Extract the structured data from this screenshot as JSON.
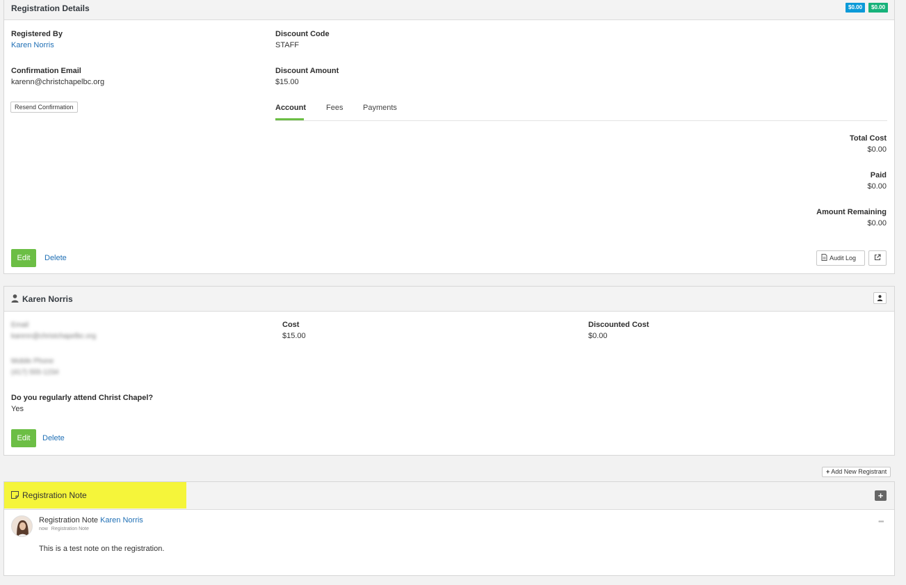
{
  "registration": {
    "title": "Registration Details",
    "badge_blue": "$0.00",
    "badge_green": "$0.00",
    "registered_by_label": "Registered By",
    "registered_by": "Karen Norris",
    "confirmation_email_label": "Confirmation Email",
    "confirmation_email": "karenn@christchapelbc.org",
    "resend_button": "Resend Confirmation",
    "discount_code_label": "Discount Code",
    "discount_code": "STAFF",
    "discount_amount_label": "Discount Amount",
    "discount_amount": "$15.00",
    "tabs": [
      "Account",
      "Fees",
      "Payments"
    ],
    "total_cost_label": "Total Cost",
    "total_cost": "$0.00",
    "paid_label": "Paid",
    "paid": "$0.00",
    "remaining_label": "Amount Remaining",
    "remaining": "$0.00",
    "edit_button": "Edit",
    "delete_link": "Delete",
    "audit_log_button": "Audit Log"
  },
  "registrant": {
    "name": "Karen Norris",
    "email_label": "Email",
    "email": "karenn@christchapelbc.org",
    "phone_label": "Mobile Phone",
    "phone": "(417) 555-1234",
    "question": "Do you regularly attend Christ Chapel?",
    "answer": "Yes",
    "cost_label": "Cost",
    "cost": "$15.00",
    "discounted_label": "Discounted Cost",
    "discounted": "$0.00",
    "edit_button": "Edit",
    "delete_link": "Delete",
    "add_button": "Add New Registrant"
  },
  "note": {
    "title": "Registration Note",
    "entry_type": "Registration Note",
    "author": "Karen Norris",
    "time": "now",
    "sub_type": "Registration Note",
    "text": "This is a test note on the registration."
  },
  "colors": {
    "accent_green": "#6cbe45",
    "badge_blue": "#0b9ad8",
    "badge_green": "#17b27a",
    "highlight": "#f5f53a",
    "link": "#1f6fb5"
  }
}
